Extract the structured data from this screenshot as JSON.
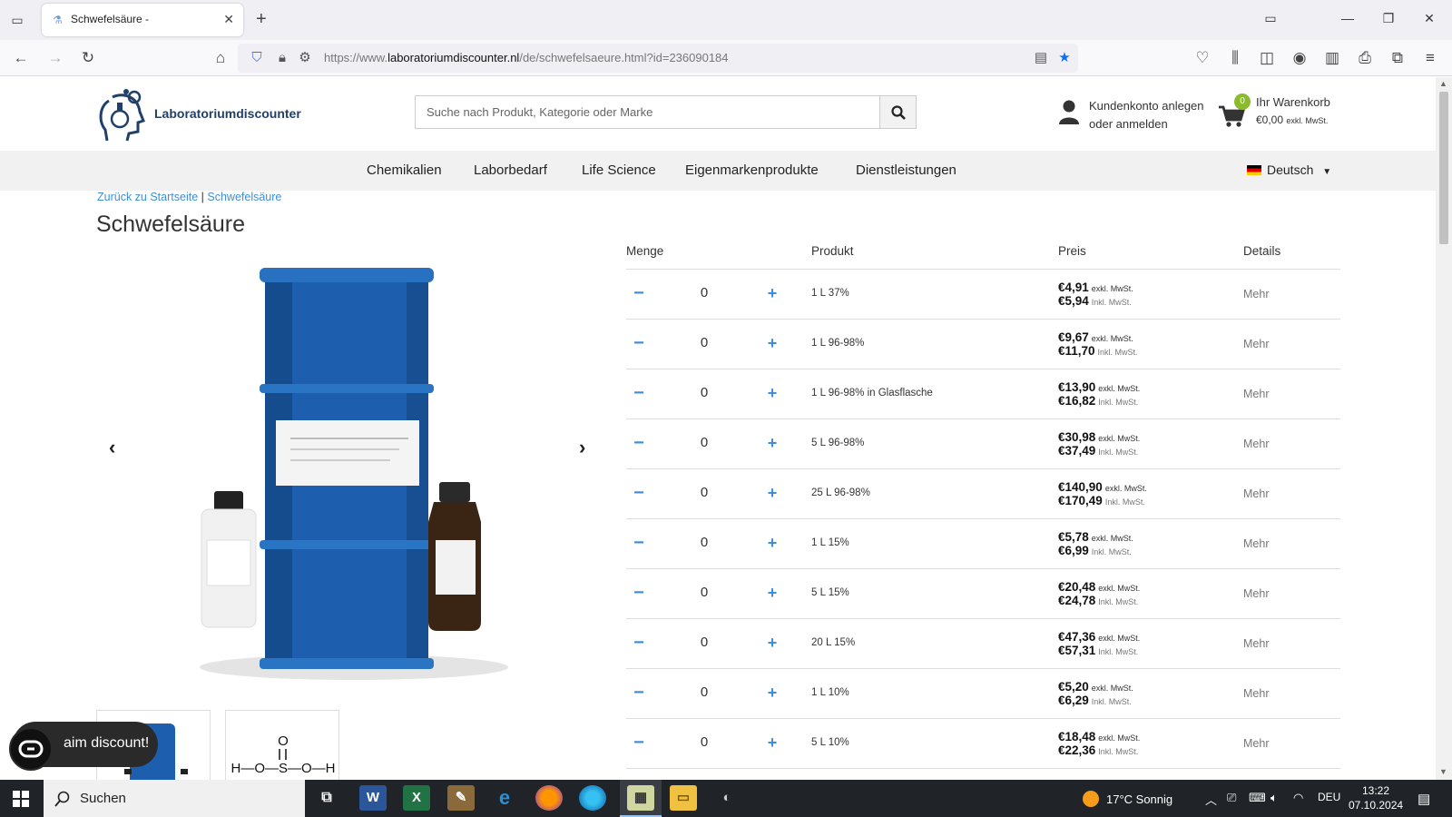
{
  "browser": {
    "tab_title": "Schwefelsäure -",
    "url_prefix": "https://www.",
    "url_domain": "laboratoriumdiscounter.nl",
    "url_path": "/de/schwefelsaeure.html?id=236090184"
  },
  "site": {
    "logo_text": "Laboratoriumdiscounter",
    "search_placeholder": "Suche nach Produkt, Kategorie oder Marke",
    "account_line1": "Kundenkonto anlegen",
    "account_line2": "oder anmelden",
    "cart_count": "0",
    "cart_label": "Ihr Warenkorb",
    "cart_amount": "€0,00",
    "cart_tax_note": "exkl. MwSt.",
    "language": "Deutsch"
  },
  "menu": [
    "Chemikalien",
    "Laborbedarf",
    "Life Science",
    "Eigenmarkenprodukte",
    "Dienstleistungen"
  ],
  "breadcrumb": {
    "home": "Zurück zu Startseite",
    "separator": "|",
    "current": "Schwefelsäure"
  },
  "product": {
    "title": "Schwefelsäure",
    "formula_top": "O",
    "formula_mid": "H—O—S—O—H"
  },
  "table": {
    "headers": {
      "qty": "Menge",
      "product": "Produkt",
      "price": "Preis",
      "details": "Details"
    },
    "rows": [
      {
        "qty": "0",
        "name": "1 L 37%",
        "ex": "€4,91",
        "in": "€5,94",
        "ex_label": "exkl. MwSt.",
        "in_label": "Inkl. MwSt.",
        "more": "Mehr"
      },
      {
        "qty": "0",
        "name": "1 L 96-98%",
        "ex": "€9,67",
        "in": "€11,70",
        "ex_label": "exkl. MwSt.",
        "in_label": "Inkl. MwSt.",
        "more": "Mehr"
      },
      {
        "qty": "0",
        "name": "1 L 96-98% in Glasflasche",
        "ex": "€13,90",
        "in": "€16,82",
        "ex_label": "exkl. MwSt.",
        "in_label": "Inkl. MwSt.",
        "more": "Mehr"
      },
      {
        "qty": "0",
        "name": "5 L 96-98%",
        "ex": "€30,98",
        "in": "€37,49",
        "ex_label": "exkl. MwSt.",
        "in_label": "Inkl. MwSt.",
        "more": "Mehr"
      },
      {
        "qty": "0",
        "name": "25 L 96-98%",
        "ex": "€140,90",
        "in": "€170,49",
        "ex_label": "exkl. MwSt.",
        "in_label": "Inkl. MwSt.",
        "more": "Mehr"
      },
      {
        "qty": "0",
        "name": "1 L 15%",
        "ex": "€5,78",
        "in": "€6,99",
        "ex_label": "exkl. MwSt.",
        "in_label": "Inkl. MwSt.",
        "more": "Mehr"
      },
      {
        "qty": "0",
        "name": "5 L 15%",
        "ex": "€20,48",
        "in": "€24,78",
        "ex_label": "exkl. MwSt.",
        "in_label": "Inkl. MwSt.",
        "more": "Mehr"
      },
      {
        "qty": "0",
        "name": "20 L 15%",
        "ex": "€47,36",
        "in": "€57,31",
        "ex_label": "exkl. MwSt.",
        "in_label": "Inkl. MwSt.",
        "more": "Mehr"
      },
      {
        "qty": "0",
        "name": "1 L 10%",
        "ex": "€5,20",
        "in": "€6,29",
        "ex_label": "exkl. MwSt.",
        "in_label": "Inkl. MwSt.",
        "more": "Mehr"
      },
      {
        "qty": "0",
        "name": "5 L 10%",
        "ex": "€18,48",
        "in": "€22,36",
        "ex_label": "exkl. MwSt.",
        "in_label": "Inkl. MwSt.",
        "more": "Mehr"
      }
    ]
  },
  "chat": {
    "text": "aim discount!"
  },
  "taskbar": {
    "search": "Suchen",
    "weather": "17°C  Sonnig",
    "lang": "DEU",
    "time": "13:22",
    "date": "07.10.2024"
  },
  "colors": {
    "accent": "#3f8ed8",
    "barrel": "#1d5fae",
    "cart_badge": "#8bbb2c"
  }
}
